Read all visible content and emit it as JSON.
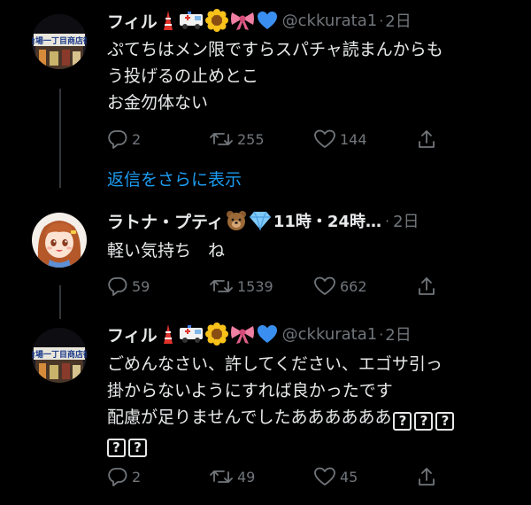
{
  "tweets": [
    {
      "name": "フィル",
      "handle": "@ckkurata1",
      "time": "2日",
      "text_lines": [
        "ぷてちはメン限ですらスパチャ読まんからも",
        "う投げるの止めとこ",
        "お金勿体ない"
      ],
      "replies": "2",
      "retweets": "255",
      "likes": "144"
    },
    {
      "name": "ラトナ・プティ",
      "name_suffix": "11時・24時…",
      "time": "2日",
      "text_lines": [
        "軽い気持ち　ね"
      ],
      "replies": "59",
      "retweets": "1539",
      "likes": "662"
    },
    {
      "name": "フィル",
      "handle": "@ckkurata1",
      "time": "2日",
      "text_lines": [
        "ごめんなさい、許してください、エゴサ引っ",
        "掛からないようにすれば良かったです",
        "配慮が足りませんでしたああああああ"
      ],
      "unknown_glyph": "?",
      "replies": "2",
      "retweets": "49",
      "likes": "45"
    }
  ],
  "show_replies": "返信をさらに表示",
  "separator": "·",
  "icons": {
    "reply": "reply-icon",
    "retweet": "retweet-icon",
    "like": "heart-icon",
    "share": "share-icon",
    "name_emojis": [
      "tokyo-tower-emoji",
      "ambulance-emoji",
      "sunflower-emoji",
      "ribbon-emoji",
      "blue-heart-emoji"
    ],
    "name_emojis_2": [
      "bear-emoji",
      "gem-emoji"
    ]
  },
  "colors": {
    "background": "#000000",
    "text": "#e7e9ea",
    "muted": "#71767b",
    "link": "#1d9bf0",
    "thread_line": "#333639"
  }
}
